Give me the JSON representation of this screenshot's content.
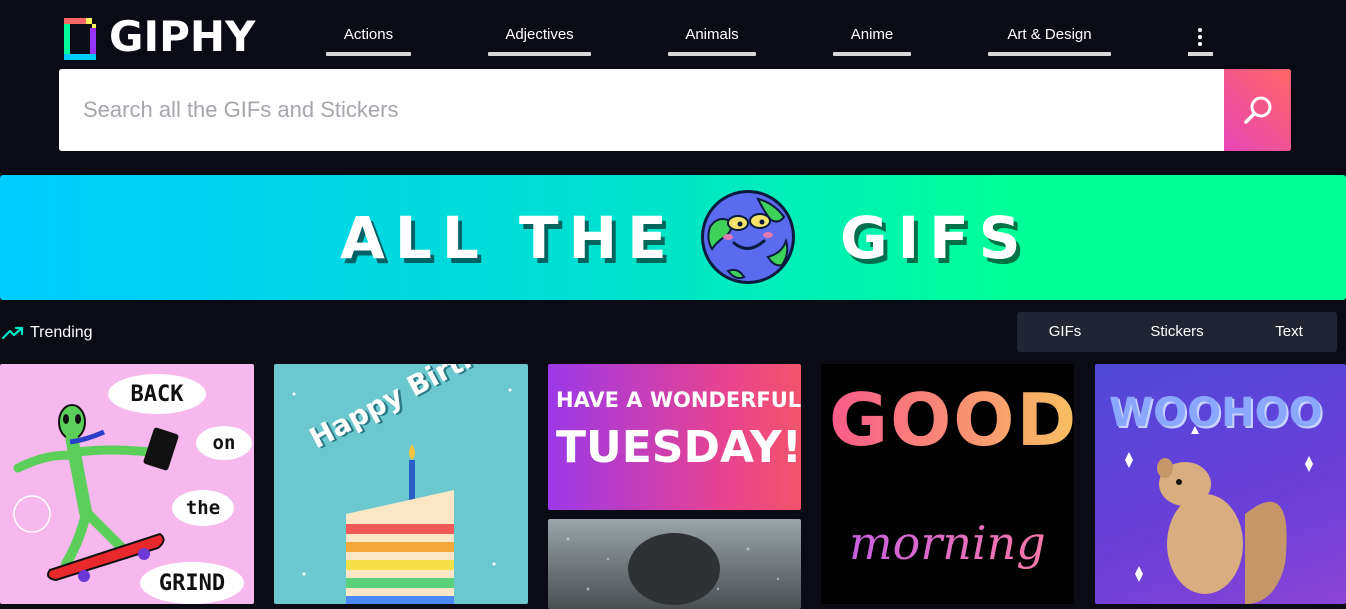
{
  "brand": {
    "name": "GIPHY"
  },
  "nav": {
    "items": [
      {
        "label": "Actions"
      },
      {
        "label": "Adjectives"
      },
      {
        "label": "Animals"
      },
      {
        "label": "Anime"
      },
      {
        "label": "Art & Design"
      }
    ],
    "more_icon": "vertical-ellipsis-icon"
  },
  "search": {
    "placeholder": "Search all the GIFs and Stickers",
    "value": "",
    "button_icon": "search-icon"
  },
  "banner": {
    "word_left": "ALL THE",
    "word_right": "GIFS",
    "image": "globe-mascot"
  },
  "trending": {
    "label": "Trending",
    "icon": "trending-up-icon"
  },
  "tabs": [
    {
      "label": "GIFs"
    },
    {
      "label": "Stickers"
    },
    {
      "label": "Text"
    }
  ],
  "gifs": {
    "card1": {
      "words": [
        "BACK",
        "on",
        "the",
        "GRIND"
      ]
    },
    "card2": {
      "text": "Happy Birthday!"
    },
    "card3": {
      "line1": "HAVE A WONDERFUL",
      "line2": "TUESDAY!"
    },
    "card5": {
      "line1": "GOOD",
      "line2": "morning"
    },
    "card6": {
      "text": "WOOHOO"
    }
  },
  "colors": {
    "background": "#0a0b14",
    "search_button_start": "#e646b6",
    "search_button_end": "#ff6666",
    "banner_start": "#00ccff",
    "banner_end": "#00ff99",
    "trending_icon": "#00e6cc",
    "tabs_bg": "#212433"
  }
}
